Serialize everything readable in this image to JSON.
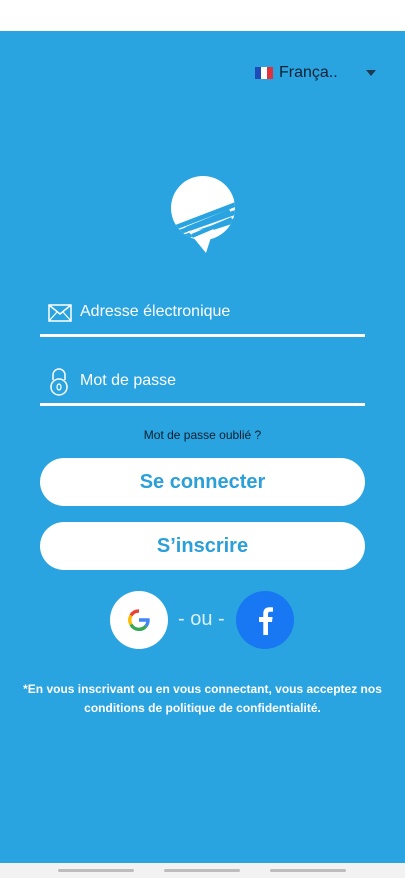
{
  "language": {
    "flag_icon": "france-flag-icon",
    "label": "Françа..",
    "caret_icon": "caret-down-icon"
  },
  "form": {
    "email": {
      "icon": "envelope-icon",
      "placeholder": "Adresse électronique"
    },
    "password": {
      "icon": "padlock-icon",
      "placeholder": "Mot de passe"
    },
    "forgot_label": "Mot de passe oublié ?"
  },
  "buttons": {
    "login_label": "Se connecter",
    "signup_label": "S’inscrire"
  },
  "social": {
    "google_icon": "google-icon",
    "separator": "- ou -",
    "facebook_icon": "facebook-icon"
  },
  "legal": {
    "line1": "*En vous inscrivant ou en vous connectant, vous acceptez nos",
    "line2": "conditions de politique de confidentialité."
  },
  "colors": {
    "background": "#2aa4e0",
    "button_text": "#2a9fd8",
    "facebook": "#1877f2"
  }
}
